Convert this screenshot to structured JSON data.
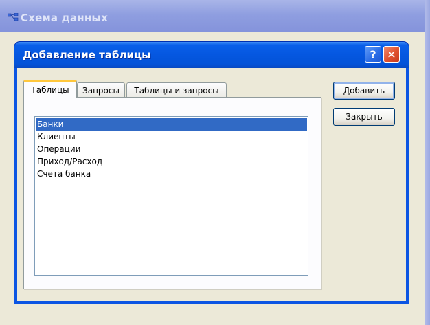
{
  "parent_window": {
    "title": "Схема данных"
  },
  "dialog": {
    "title": "Добавление таблицы",
    "help_label": "?",
    "close_label": "✕"
  },
  "tabs": [
    {
      "label": "Таблицы",
      "active": true
    },
    {
      "label": "Запросы",
      "active": false
    },
    {
      "label": "Таблицы и запросы",
      "active": false
    }
  ],
  "list": {
    "items": [
      "Банки",
      "Клиенты",
      "Операции",
      "Приход/Расход",
      "Счета банка"
    ],
    "selected_index": 0
  },
  "buttons": {
    "add_label": "Добавить",
    "close_label": "Закрыть"
  },
  "colors": {
    "title_blue": "#0557e0",
    "selection": "#316ac5",
    "tab_highlight": "#ffc73c"
  },
  "icons": {
    "parent": "relationships-icon",
    "help": "help-icon",
    "close": "close-icon"
  }
}
